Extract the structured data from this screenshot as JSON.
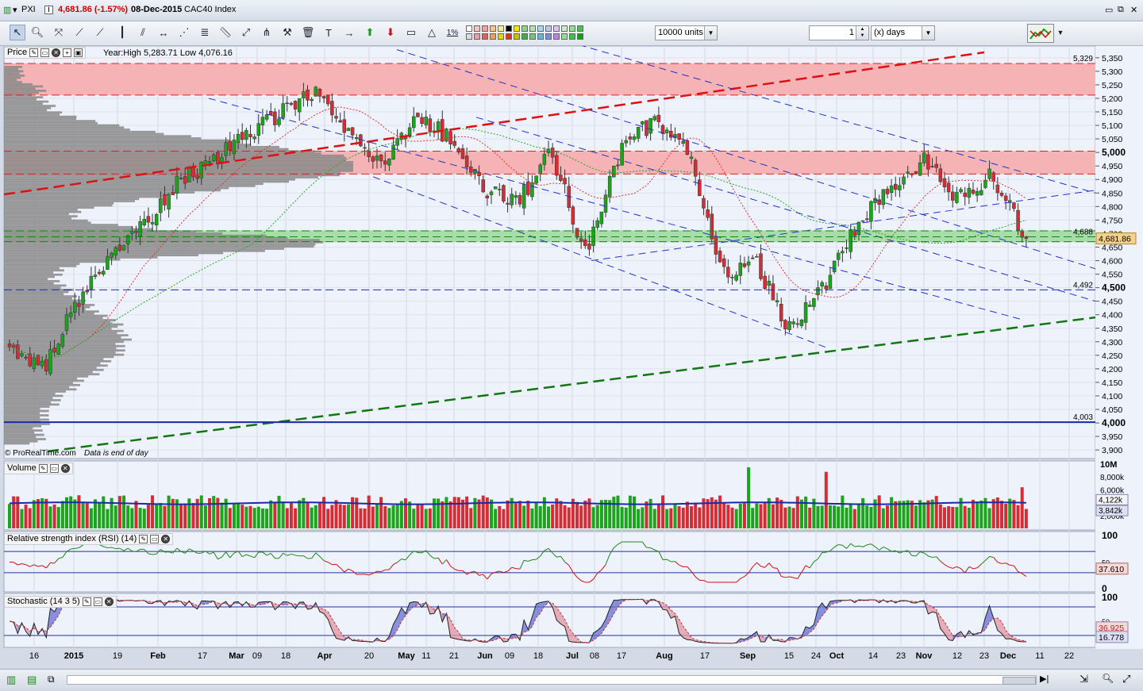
{
  "window": {
    "symbol": "PXI",
    "last_price_change": "4,681.86 (-1.57%)",
    "date": "08-Dec-2015",
    "instrument": "CAC40 Index"
  },
  "toolbar": {
    "units_value": "10000 units",
    "period_count": "1",
    "period_unit": "(x) days",
    "percent_tool": "1%"
  },
  "price_panel": {
    "title": "Price",
    "year_range": "Year:High 5,283.71 Low 4,076.16",
    "copyright": "© ProRealTime.com",
    "eod_note": "Data is end of day",
    "last_value": "4,681.86",
    "level_labels": [
      {
        "text": "5,329",
        "value": 5329
      },
      {
        "text": "4,688",
        "value": 4688
      },
      {
        "text": "4,492",
        "value": 4492
      },
      {
        "text": "4,003",
        "value": 4003
      }
    ],
    "y_ticks": [
      "5,350",
      "5,300",
      "5,250",
      "5,200",
      "5,150",
      "5,100",
      "5,050",
      "5,000",
      "4,950",
      "4,900",
      "4,850",
      "4,800",
      "4,750",
      "4,700",
      "4,650",
      "4,600",
      "4,550",
      "4,500",
      "4,450",
      "4,400",
      "4,350",
      "4,300",
      "4,250",
      "4,200",
      "4,150",
      "4,100",
      "4,050",
      "4,000",
      "3,950",
      "3,900"
    ],
    "y_major": [
      "5,000",
      "4,500",
      "4,000"
    ]
  },
  "volume_panel": {
    "title": "Volume",
    "y_ticks": [
      "10M",
      "8,000k",
      "6,000k",
      "4,000k",
      "2,000k"
    ],
    "value_a": "4,122k",
    "value_b": "3,842k"
  },
  "rsi_panel": {
    "title": "Relative strength index (RSI) (14)",
    "y_ticks": [
      "100",
      "50",
      "0"
    ],
    "value": "37.610"
  },
  "stoch_panel": {
    "title": "Stochastic (14 3 5)",
    "y_ticks": [
      "100",
      "50"
    ],
    "value_a": "36.925",
    "value_b": "16.778"
  },
  "x_axis": {
    "labels": [
      "16",
      "2015",
      "19",
      "Feb",
      "17",
      "Mar",
      "09",
      "18",
      "Apr",
      "20",
      "May",
      "11",
      "21",
      "Jun",
      "09",
      "18",
      "Jul",
      "08",
      "17",
      "Aug",
      "17",
      "Sep",
      "15",
      "24",
      "Oct",
      "14",
      "23",
      "Nov",
      "12",
      "23",
      "Dec",
      "11",
      "22"
    ]
  },
  "colors": {
    "up": "#1aa51a",
    "down": "#d42d36",
    "resistance_zone": "#f5b3b6",
    "support_zone": "#a8dca8",
    "channel": "#2233cc",
    "red_trend": "#dd1111",
    "green_trend": "#117711"
  },
  "chart_data": {
    "type": "candlestick",
    "title": "CAC40 Index",
    "ylim": [
      3880,
      5370
    ],
    "horizontal_levels": [
      5329,
      5212,
      5005,
      4920,
      4710,
      4670,
      4688,
      4492,
      4003
    ],
    "price_path": {
      "months": [
        "Jan",
        "2015",
        "Jan19",
        "Feb",
        "Feb17",
        "Mar",
        "Mar09",
        "Mar18",
        "Apr",
        "Apr20",
        "May",
        "May11",
        "May21",
        "Jun",
        "Jun09",
        "Jun18",
        "Jul",
        "Jul08",
        "Jul17",
        "Aug",
        "Aug17",
        "Sep",
        "Sep15",
        "Sep24",
        "Oct",
        "Oct14",
        "Oct23",
        "Nov",
        "Nov12",
        "Nov23",
        "Dec"
      ],
      "close": [
        4270,
        4200,
        4450,
        4620,
        4730,
        4900,
        4970,
        5060,
        5150,
        5230,
        5060,
        4960,
        5130,
        5060,
        4860,
        4820,
        5000,
        4620,
        5000,
        5120,
        5010,
        4550,
        4600,
        4350,
        4500,
        4720,
        4880,
        4980,
        4830,
        4920,
        4681.86
      ]
    }
  }
}
